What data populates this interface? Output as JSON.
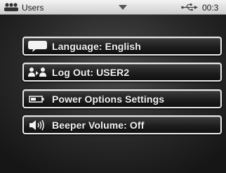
{
  "status_bar": {
    "title": "Users",
    "clock": "00:3",
    "icons": {
      "left": "users-icon",
      "center": "chevron-down-icon",
      "connection": "usb-icon"
    }
  },
  "menu": {
    "items": [
      {
        "label": "Language: English",
        "icon": "speech-bubble-icon"
      },
      {
        "label": "Log Out: USER2",
        "icon": "user-switch-icon"
      },
      {
        "label": "Power Options Settings",
        "icon": "battery-icon"
      },
      {
        "label": "Beeper Volume: Off",
        "icon": "speaker-icon"
      }
    ]
  },
  "colors": {
    "status_bar_bg": "#e6e6e6",
    "button_border": "#e8e8e8",
    "button_text": "#f2f2f2",
    "screen_bg": "#2a2a2a"
  }
}
